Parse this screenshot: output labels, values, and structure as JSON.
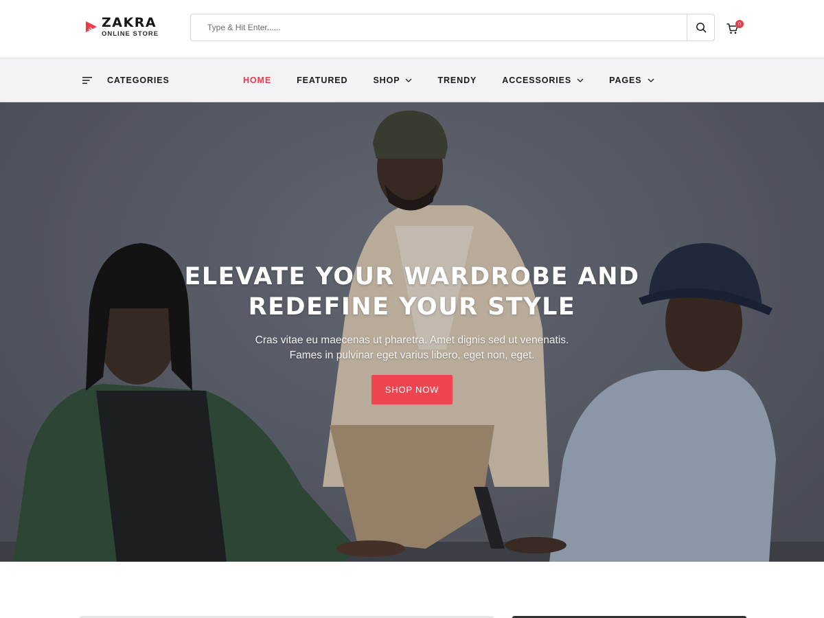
{
  "brand": {
    "name": "ZAKRA",
    "tagline": "ONLINE STORE",
    "accent": "#ef3a4a"
  },
  "search": {
    "placeholder": "Type & Hit Enter......",
    "icon": "search-icon"
  },
  "cart": {
    "icon": "cart-icon",
    "count": "0"
  },
  "nav": {
    "categories_label": "CATEGORIES",
    "items": [
      {
        "label": "HOME",
        "active": true,
        "has_dropdown": false
      },
      {
        "label": "FEATURED",
        "active": false,
        "has_dropdown": false
      },
      {
        "label": "SHOP",
        "active": false,
        "has_dropdown": true
      },
      {
        "label": "TRENDY",
        "active": false,
        "has_dropdown": false
      },
      {
        "label": "ACCESSORIES",
        "active": false,
        "has_dropdown": true
      },
      {
        "label": "PAGES",
        "active": false,
        "has_dropdown": true
      }
    ]
  },
  "hero": {
    "title_line1": "ELEVATE YOUR WARDROBE AND",
    "title_line2": "REDEFINE YOUR STYLE",
    "subtitle_line1": "Cras vitae eu maecenas ut pharetra. Amet dignis sed ut venenatis.",
    "subtitle_line2": "Fames in pulvinar eget varius libero, eget non, eget.",
    "button_label": "SHOP NOW",
    "button_color": "#ee4550"
  }
}
